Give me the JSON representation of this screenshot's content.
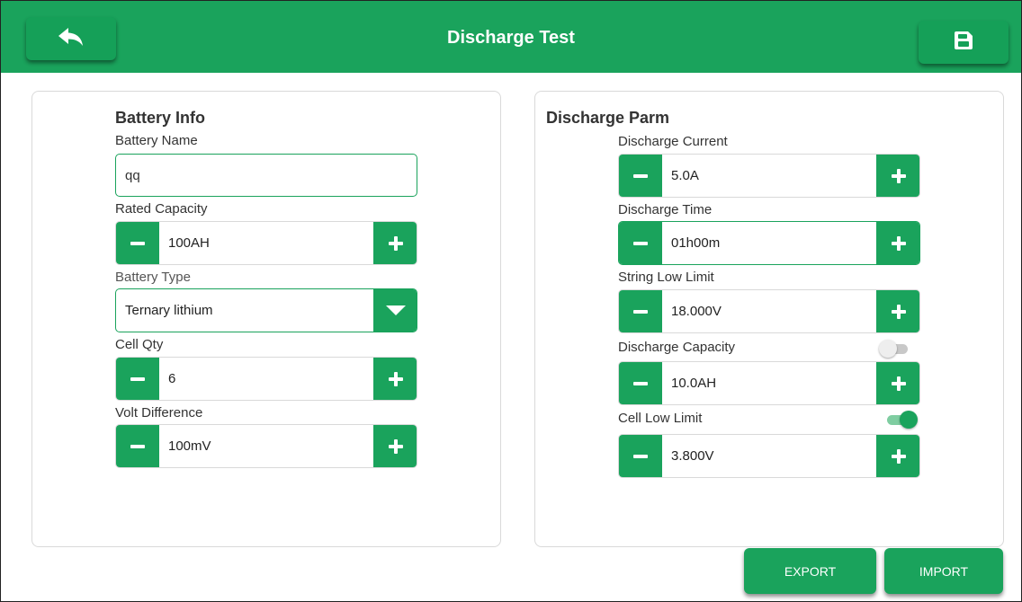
{
  "header": {
    "title": "Discharge Test",
    "back_icon": "back-arrow-icon",
    "save_icon": "floppy-save-icon",
    "color": "#1aa35c"
  },
  "battery_info": {
    "title": "Battery Info",
    "battery_name": {
      "label": "Battery Name",
      "value": "qq"
    },
    "rated_capacity": {
      "label": "Rated Capacity",
      "value": "100AH"
    },
    "battery_type": {
      "label": "Battery Type",
      "value": "Ternary lithium"
    },
    "cell_qty": {
      "label": "Cell Qty",
      "value": "6"
    },
    "volt_difference": {
      "label": "Volt Difference",
      "value": "100mV"
    }
  },
  "discharge_parm": {
    "title": "Discharge Parm",
    "discharge_current": {
      "label": "Discharge Current",
      "value": "5.0A"
    },
    "discharge_time": {
      "label": "Discharge Time",
      "value": "01h00m"
    },
    "string_low_limit": {
      "label": "String Low Limit",
      "value": "18.000V"
    },
    "discharge_capacity": {
      "label": "Discharge Capacity",
      "value": "10.0AH",
      "enabled": false
    },
    "cell_low_limit": {
      "label": "Cell Low Limit",
      "value": "3.800V",
      "enabled": true
    }
  },
  "actions": {
    "export_label": "EXPORT",
    "import_label": "IMPORT"
  }
}
